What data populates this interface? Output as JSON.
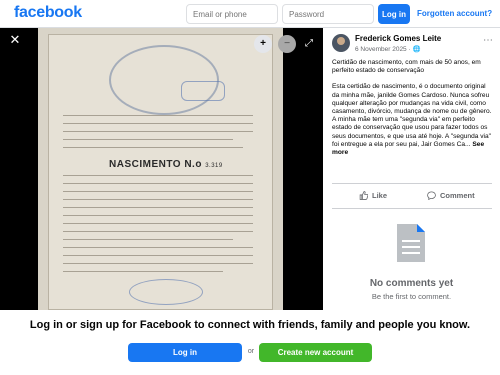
{
  "header": {
    "logo": "facebook",
    "email_placeholder": "Email or phone",
    "password_placeholder": "Password",
    "login_label": "Log in",
    "forgot_label": "Forgotten account?"
  },
  "photo": {
    "close_icon": "close-icon",
    "document_title": "NASCIMENTO N.o",
    "document_number": "3.319"
  },
  "post": {
    "author": "Frederick Gomes Leite",
    "date": "6 November 2025 · ",
    "text_1": "Certidão de nascimento, com mais de 50 anos, em perfeito estado de conservação",
    "text_2": "Esta certidão de nascimento, é o documento original da minha mãe, janilde Gomes Cardoso. Nunca sofreu qualquer alteração por mudanças na vida civil, como casamento, divórcio, mudança de nome ou de gênero. A minha mãe tem uma \"segunda via\" em perfeito estado de conservação que usou para fazer todos os seus documentos, e que usa até hoje. A \"segunda via\" foi entregue a ela por seu pai, Jair Gomes Ca...",
    "see_more": "See more",
    "like_label": "Like",
    "comment_label": "Comment",
    "no_comments": "No comments yet",
    "be_first": "Be the first to comment."
  },
  "footer": {
    "title": "Log in or sign up for Facebook to connect with friends, family and people you know.",
    "login_label": "Log in",
    "or_label": "or",
    "create_label": "Create new account"
  },
  "colors": {
    "brand": "#1877f2",
    "create_green": "#42b72a"
  }
}
